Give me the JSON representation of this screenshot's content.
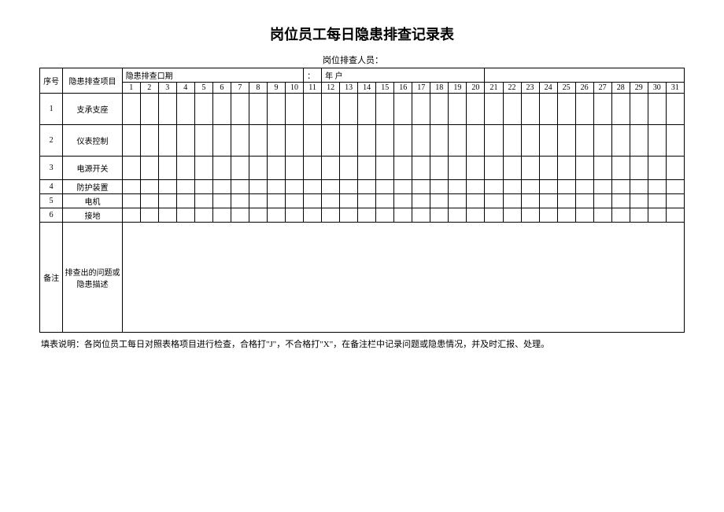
{
  "title": "岗位员工每日隐患排查记录表",
  "header": {
    "inspector_label": "岗位排查人员：",
    "date_label_prefix": "隐患排查口期",
    "date_label_colon": "：",
    "date_label_suffix": "年 户"
  },
  "columns": {
    "seq": "序号",
    "item": "隐患排查项目",
    "days": [
      "1",
      "2",
      "3",
      "4",
      "5",
      "6",
      "7",
      "8",
      "9",
      "10",
      "11",
      "12",
      "13",
      "14",
      "15",
      "16",
      "17",
      "18",
      "19",
      "20",
      "21",
      "22",
      "23",
      "24",
      "25",
      "26",
      "27",
      "28",
      "29",
      "30",
      "31"
    ]
  },
  "rows": [
    {
      "seq": "1",
      "item": "支承支座"
    },
    {
      "seq": "2",
      "item": "仪表控制"
    },
    {
      "seq": "3",
      "item": "电源开关"
    },
    {
      "seq": "4",
      "item": "防护装置"
    },
    {
      "seq": "5",
      "item": "电机"
    },
    {
      "seq": "6",
      "item": "接地"
    }
  ],
  "remark": {
    "label": "备注",
    "desc": "排查出的问题或隐患描述"
  },
  "footnote": "填表说明：各岗位员工每日对照表格项目进行检查，合格打\"J\"，不合格打\"X\"，在备注栏中记录问题或隐患情况，并及时汇报、处理。"
}
